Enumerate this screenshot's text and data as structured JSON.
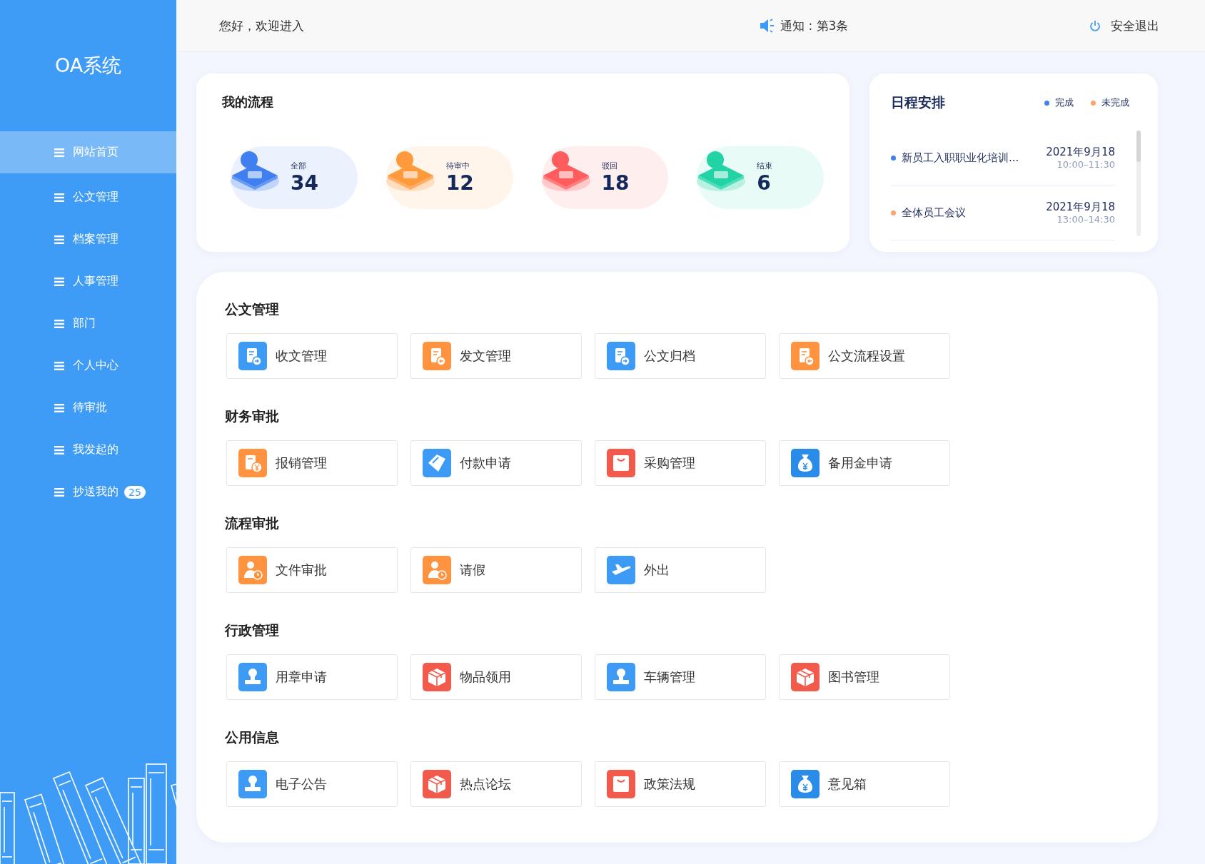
{
  "sidebar": {
    "logo": "OA系统",
    "items": [
      {
        "label": "网站首页",
        "selected": true
      },
      {
        "label": "公文管理",
        "selected": false
      },
      {
        "label": "档案管理",
        "selected": false
      },
      {
        "label": "人事管理",
        "selected": false
      },
      {
        "label": "部门",
        "selected": false
      },
      {
        "label": "个人中心",
        "selected": false
      },
      {
        "label": "待审批",
        "selected": false
      },
      {
        "label": "我发起的",
        "selected": false
      },
      {
        "label": "抄送我的",
        "selected": false,
        "badge": "25"
      }
    ]
  },
  "header": {
    "greeting": "您好，欢迎进入",
    "notice": "通知 : 第3条",
    "logout": "安全退出"
  },
  "my_flow": {
    "title": "我的流程",
    "stats": [
      {
        "label": "全部",
        "count": "34",
        "color": "#3f7ff0"
      },
      {
        "label": "待审中",
        "count": "12",
        "color": "#ff9a3c"
      },
      {
        "label": "驳回",
        "count": "18",
        "color": "#ff5d5d"
      },
      {
        "label": "结束",
        "count": "6",
        "color": "#22d3a6"
      }
    ]
  },
  "schedule": {
    "title": "日程安排",
    "legend": [
      {
        "label": "完成",
        "color": "#3f7ff0"
      },
      {
        "label": "未完成",
        "color": "#ffa36c"
      }
    ],
    "items": [
      {
        "title": "新员工入职职业化培训...",
        "date": "2021年9月18",
        "time": "10:00–11:30",
        "color": "#3f7ff0"
      },
      {
        "title": "全体员工会议",
        "date": "2021年9月18",
        "time": "13:00–14:30",
        "color": "#ffa36c"
      }
    ]
  },
  "sections": [
    {
      "title": "公文管理",
      "tiles": [
        {
          "label": "收文管理",
          "kind": "doc-in",
          "color": "#3d9bf5"
        },
        {
          "label": "发文管理",
          "kind": "doc-out",
          "color": "#ff9340"
        },
        {
          "label": "公文归档",
          "kind": "doc-in",
          "color": "#3d9bf5"
        },
        {
          "label": "公文流程设置",
          "kind": "doc-out",
          "color": "#ff9340"
        }
      ]
    },
    {
      "title": "财务审批",
      "tiles": [
        {
          "label": "报销管理",
          "kind": "receipt",
          "color": "#ff9340"
        },
        {
          "label": "付款申请",
          "kind": "tag",
          "color": "#3d9bf5"
        },
        {
          "label": "采购管理",
          "kind": "bag",
          "color": "#f25a4b"
        },
        {
          "label": "备用金申请",
          "kind": "money",
          "color": "#2b8be8"
        }
      ]
    },
    {
      "title": "流程审批",
      "tiles": [
        {
          "label": "文件审批",
          "kind": "person-clock",
          "color": "#ff9340"
        },
        {
          "label": "请假",
          "kind": "person-clock",
          "color": "#ff9340"
        },
        {
          "label": "外出",
          "kind": "plane",
          "color": "#3d9bf5"
        }
      ]
    },
    {
      "title": "行政管理",
      "tiles": [
        {
          "label": "用章申请",
          "kind": "stamp",
          "color": "#3d9bf5"
        },
        {
          "label": "物品领用",
          "kind": "box",
          "color": "#f25a4b"
        },
        {
          "label": "车辆管理",
          "kind": "stamp",
          "color": "#3d9bf5"
        },
        {
          "label": "图书管理",
          "kind": "box",
          "color": "#f25a4b"
        }
      ]
    },
    {
      "title": "公用信息",
      "tiles": [
        {
          "label": "电子公告",
          "kind": "stamp",
          "color": "#3d9bf5"
        },
        {
          "label": "热点论坛",
          "kind": "box",
          "color": "#f25a4b"
        },
        {
          "label": "政策法规",
          "kind": "bag",
          "color": "#f25a4b"
        },
        {
          "label": "意见箱",
          "kind": "money",
          "color": "#2b8be8"
        }
      ]
    }
  ]
}
